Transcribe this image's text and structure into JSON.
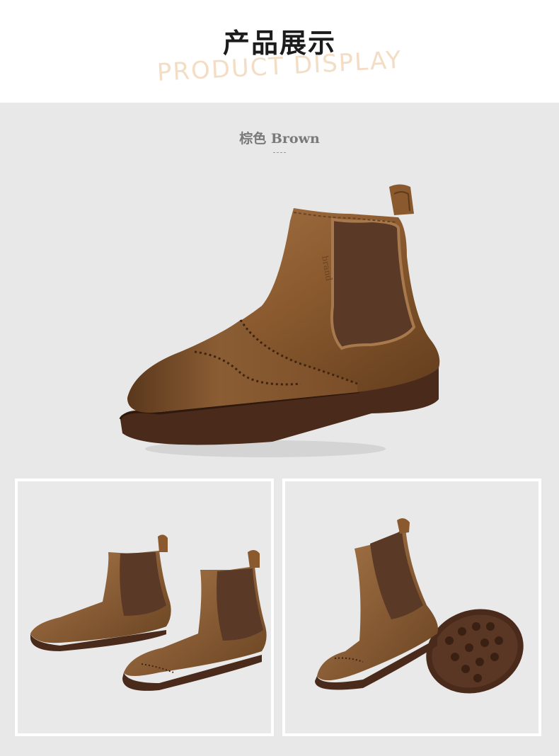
{
  "header": {
    "title_cn": "产品展示",
    "title_en": "PRODUCT DISPLAY"
  },
  "product": {
    "color_label": "棕色 Brown",
    "accent_color": "#8a5a2e",
    "sole_color": "#4a2a1a",
    "elastic_color": "#5a3a26"
  },
  "images": {
    "hero": "brown-chelsea-boot-side-view",
    "panel_left": "pair-of-brown-chelsea-boots",
    "panel_right": "boot-with-outsole-view"
  }
}
